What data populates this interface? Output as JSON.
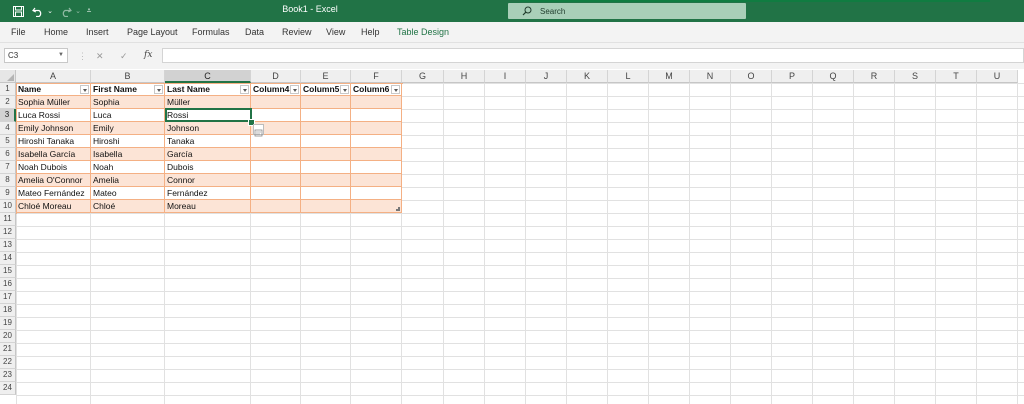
{
  "window": {
    "title": "Book1  -  Excel"
  },
  "search": {
    "placeholder": "Search"
  },
  "ribbon": {
    "tabs": [
      {
        "label": "File"
      },
      {
        "label": "Home"
      },
      {
        "label": "Insert"
      },
      {
        "label": "Page Layout"
      },
      {
        "label": "Formulas"
      },
      {
        "label": "Data"
      },
      {
        "label": "Review"
      },
      {
        "label": "View"
      },
      {
        "label": "Help"
      },
      {
        "label": "Table Design"
      }
    ]
  },
  "formula_bar": {
    "name_box": "C3",
    "fx": "fx",
    "cancel": "✕",
    "enter": "✓",
    "value": ""
  },
  "columns": [
    "A",
    "B",
    "C",
    "D",
    "E",
    "F",
    "G",
    "H",
    "I",
    "J",
    "K",
    "L",
    "M",
    "N",
    "O",
    "P",
    "Q",
    "R",
    "S",
    "T",
    "U"
  ],
  "rows": [
    "1",
    "2",
    "3",
    "4",
    "5",
    "6",
    "7",
    "8",
    "9",
    "10",
    "11",
    "12",
    "13",
    "14",
    "15",
    "16",
    "17",
    "18",
    "19",
    "20",
    "21",
    "22",
    "23",
    "24"
  ],
  "table": {
    "headers": [
      "Name",
      "First Name",
      "Last Name",
      "Column4",
      "Column5",
      "Column6"
    ],
    "rows": [
      [
        "Sophia Müller",
        "Sophia",
        "Müller",
        "",
        "",
        ""
      ],
      [
        "Luca Rossi",
        "Luca",
        "Rossi",
        "",
        "",
        ""
      ],
      [
        "Emily Johnson",
        "Emily",
        "Johnson",
        "",
        "",
        ""
      ],
      [
        "Hiroshi Tanaka",
        "Hiroshi",
        "Tanaka",
        "",
        "",
        ""
      ],
      [
        "Isabella García",
        "Isabella",
        "García",
        "",
        "",
        ""
      ],
      [
        "Noah Dubois",
        "Noah",
        "Dubois",
        "",
        "",
        ""
      ],
      [
        "Amelia O'Connor",
        "Amelia",
        "Connor",
        "",
        "",
        ""
      ],
      [
        "Mateo Fernández",
        "Mateo",
        "Fernández",
        "",
        "",
        ""
      ],
      [
        "Chloé Moreau",
        "Chloé",
        "Moreau",
        "",
        "",
        ""
      ]
    ]
  },
  "colors": {
    "accent": "#217346",
    "table_band": "#fce4d6",
    "table_border": "#f4b084"
  }
}
